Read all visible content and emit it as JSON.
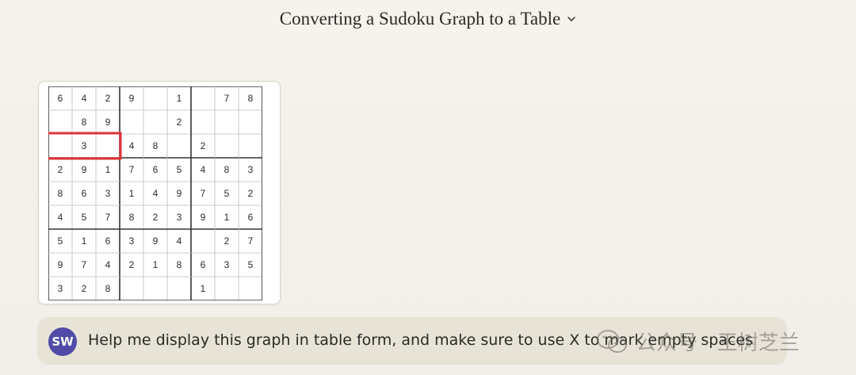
{
  "header": {
    "title": "Converting a Sudoku Graph to a Table"
  },
  "sudoku": {
    "grid": [
      [
        "6",
        "4",
        "2",
        "9",
        "",
        "1",
        "",
        "7",
        "8"
      ],
      [
        "",
        "8",
        "9",
        "",
        "",
        "2",
        "",
        "",
        ""
      ],
      [
        "",
        "3",
        "",
        "4",
        "8",
        "",
        "2",
        "",
        ""
      ],
      [
        "2",
        "9",
        "1",
        "7",
        "6",
        "5",
        "4",
        "8",
        "3"
      ],
      [
        "8",
        "6",
        "3",
        "1",
        "4",
        "9",
        "7",
        "5",
        "2"
      ],
      [
        "4",
        "5",
        "7",
        "8",
        "2",
        "3",
        "9",
        "1",
        "6"
      ],
      [
        "5",
        "1",
        "6",
        "3",
        "9",
        "4",
        "",
        "2",
        "7"
      ],
      [
        "9",
        "7",
        "4",
        "2",
        "1",
        "8",
        "6",
        "3",
        "5"
      ],
      [
        "3",
        "2",
        "8",
        "",
        "",
        "",
        "1",
        "",
        ""
      ]
    ],
    "highlight": {
      "row": 2,
      "col_start": 0,
      "col_end": 2,
      "color": "#e0333a"
    }
  },
  "message": {
    "avatar_initials": "SW",
    "avatar_color": "#4f4ba6",
    "text": "Help me display this graph in table form, and make sure to use X to mark empty spaces"
  },
  "watermark": {
    "text": "公众号 · 王树芝兰"
  }
}
